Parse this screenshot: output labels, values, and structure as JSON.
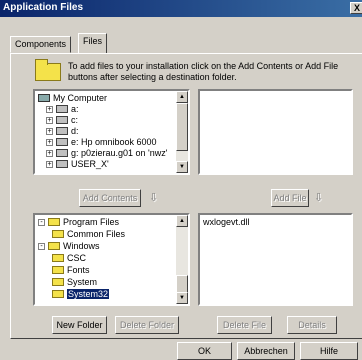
{
  "window": {
    "title": "Application Files",
    "close_glyph": "X"
  },
  "tabs": [
    "Components",
    "Files"
  ],
  "info_text": "To add files to your installation click on the Add Contents or Add File buttons after selecting a destination folder.",
  "source_tree": {
    "items": [
      {
        "label": "My Computer",
        "icon": "computer-icon",
        "expander": "",
        "indent": 0
      },
      {
        "label": "a:",
        "icon": "drive-icon",
        "expander": "+",
        "indent": 1
      },
      {
        "label": "c:",
        "icon": "drive-icon",
        "expander": "+",
        "indent": 1
      },
      {
        "label": "d:",
        "icon": "drive-icon",
        "expander": "+",
        "indent": 1
      },
      {
        "label": "e: Hp omnibook 6000",
        "icon": "drive-icon",
        "expander": "+",
        "indent": 1
      },
      {
        "label": "g: p0zierau.g01 on 'nwz'",
        "icon": "drive-icon",
        "expander": "+",
        "indent": 1
      },
      {
        "label": "USER_X'",
        "icon": "drive-icon",
        "expander": "+",
        "indent": 1
      }
    ]
  },
  "buttons": {
    "add_contents": "Add Contents",
    "add_file": "Add File",
    "new_folder": "New Folder",
    "delete_folder": "Delete Folder",
    "delete_file": "Delete File",
    "details": "Details",
    "ok": "OK",
    "cancel": "Abbrechen",
    "help": "Hilfe"
  },
  "dest_tree": {
    "items": [
      {
        "label": "Program Files",
        "expander": "-",
        "indent": 0,
        "selected": false
      },
      {
        "label": "Common Files",
        "expander": "",
        "indent": 1,
        "selected": false
      },
      {
        "label": "Windows",
        "expander": "-",
        "indent": 0,
        "selected": false
      },
      {
        "label": "CSC",
        "expander": "",
        "indent": 1,
        "selected": false
      },
      {
        "label": "Fonts",
        "expander": "",
        "indent": 1,
        "selected": false
      },
      {
        "label": "System",
        "expander": "",
        "indent": 1,
        "selected": false
      },
      {
        "label": "System32",
        "expander": "",
        "indent": 1,
        "selected": true
      }
    ]
  },
  "dest_files": [
    "wxlogevt.dll"
  ]
}
